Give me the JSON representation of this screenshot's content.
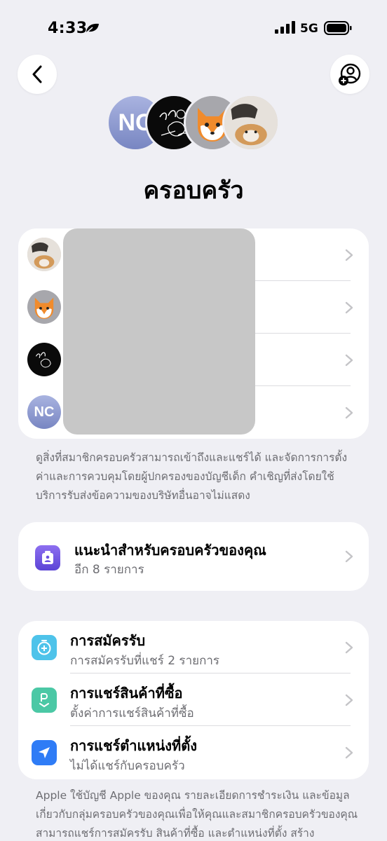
{
  "status_bar": {
    "time": "4:33",
    "network": "5G"
  },
  "header": {
    "title": "ครอบครัว",
    "avatar_initials": "NC",
    "avatar_signature_text": "ส้ม"
  },
  "members": [
    {
      "avatar": "dog-photo"
    },
    {
      "avatar": "fox-memoji"
    },
    {
      "avatar": "signature-drawing"
    },
    {
      "avatar": "initials",
      "initials": "NC"
    }
  ],
  "members_footnote": "ดูสิ่งที่สมาชิกครอบครัวสามารถเข้าถึงและแชร์ได้ และจัดการการตั้งค่าและการควบคุมโดยผู้ปกครองของบัญชีเด็ก คำเชิญที่ส่งโดยใช้บริการรับส่งข้อความของบริษัทอื่นอาจไม่แสดง",
  "recommendation": {
    "title": "แนะนำสำหรับครอบครัวของคุณ",
    "subtitle": "อีก 8 รายการ"
  },
  "settings": [
    {
      "title": "การสมัครรับ",
      "subtitle": "การสมัครรับที่แชร์ 2 รายการ",
      "icon": "subscriptions-icon",
      "color": "#4ec3ea"
    },
    {
      "title": "การแชร์สินค้าที่ซื้อ",
      "subtitle": "ตั้งค่าการแชร์สินค้าที่ซื้อ",
      "icon": "purchase-sharing-icon",
      "color": "#4bc8a5"
    },
    {
      "title": "การแชร์ตำแหน่งที่ตั้ง",
      "subtitle": "ไม่ได้แชร์กับครอบครัว",
      "icon": "location-arrow-icon",
      "color": "#2f7cf6"
    }
  ],
  "bottom_footnote": "Apple ใช้บัญชี Apple ของคุณ รายละเอียดการชำระเงิน และข้อมูลเกี่ยวกับกลุ่มครอบครัวของคุณเพื่อให้คุณและสมาชิกครอบครัวของคุณสามารถแชร์การสมัครรับ สินค้าที่ซื้อ และตำแหน่งที่ตั้ง สร้าง",
  "colors": {
    "background": "#efeff4",
    "card": "#ffffff",
    "secondary_text": "#6d6d72",
    "chevron": "#c4c4c7",
    "recommendation_icon": "#6b52e0"
  }
}
